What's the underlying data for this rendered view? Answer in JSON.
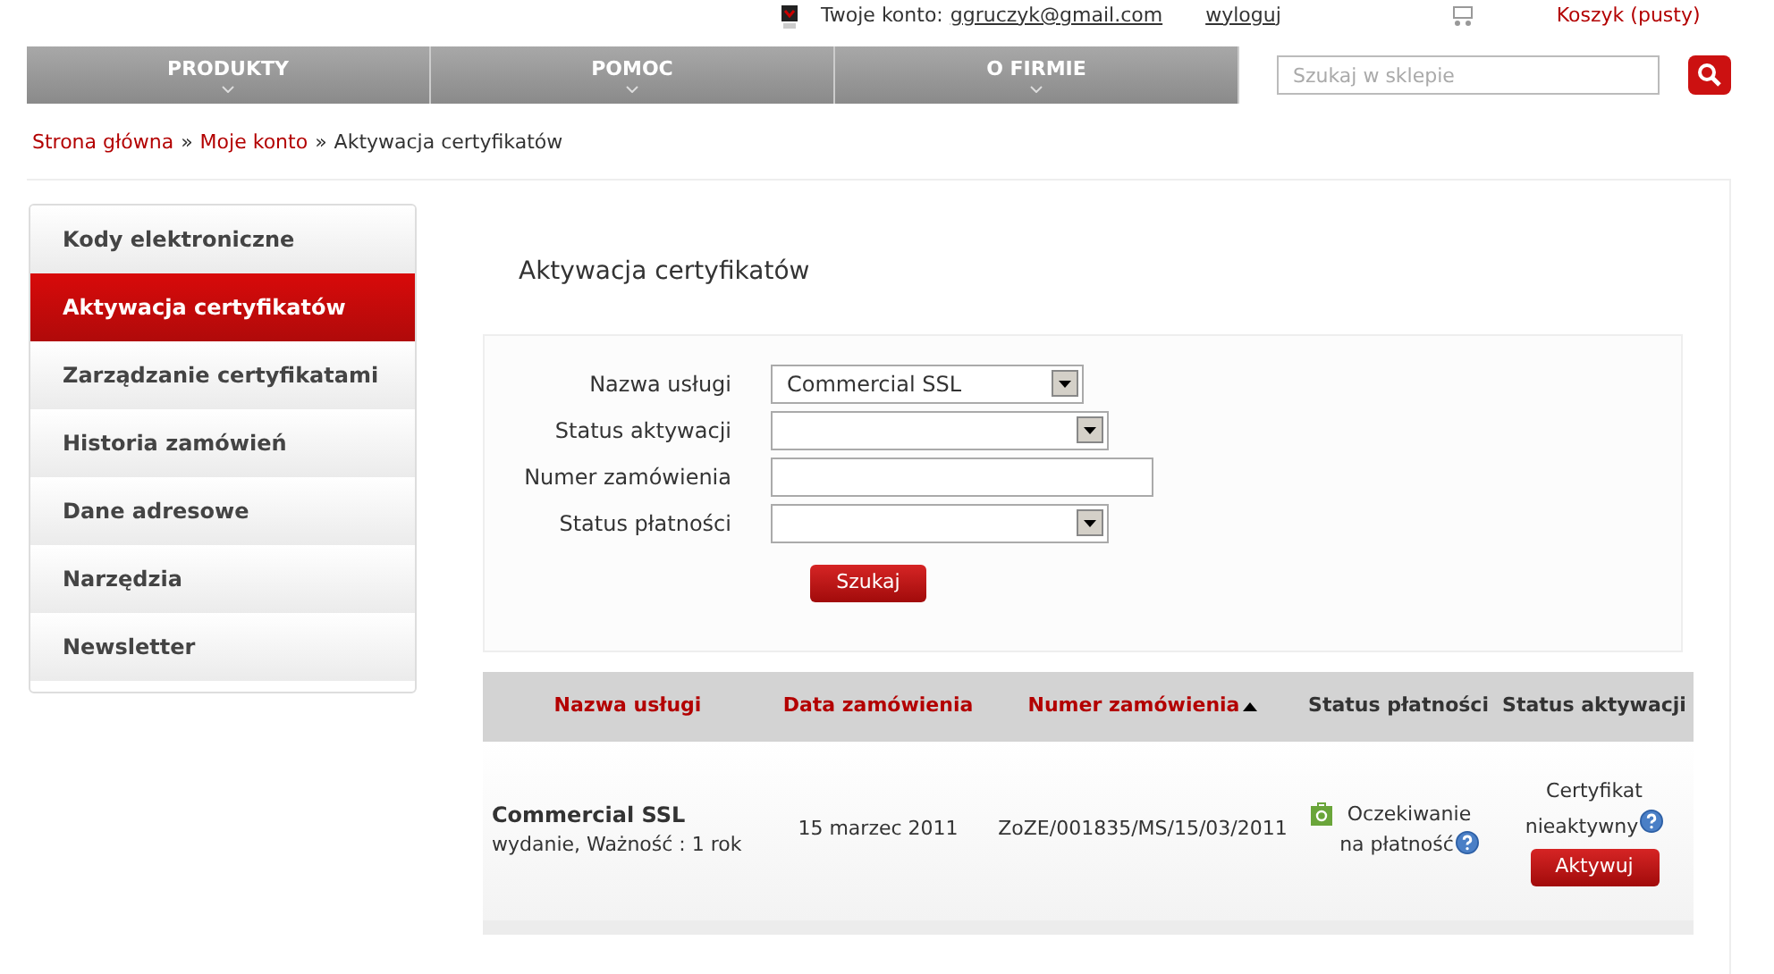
{
  "top_bar": {
    "account_label": "Twoje konto:",
    "account_email": "ggruczyk@gmail.com",
    "logout": "wyloguj",
    "cart": "Koszyk (pusty)"
  },
  "nav": [
    {
      "label": "PRODUKTY"
    },
    {
      "label": "POMOC"
    },
    {
      "label": "O FIRMIE"
    }
  ],
  "search": {
    "placeholder": "Szukaj w sklepie"
  },
  "breadcrumb": {
    "links": [
      "Strona główna",
      "Moje konto"
    ],
    "separator": "»",
    "current": "Aktywacja certyfikatów"
  },
  "sidebar": {
    "items": [
      {
        "label": "Kody elektroniczne",
        "selected": false
      },
      {
        "label": "Aktywacja certyfikatów",
        "selected": true
      },
      {
        "label": "Zarządzanie certyfikatami",
        "selected": false
      },
      {
        "label": "Historia zamówień",
        "selected": false
      },
      {
        "label": "Dane adresowe",
        "selected": false
      },
      {
        "label": "Narzędzia",
        "selected": false
      },
      {
        "label": "Newsletter",
        "selected": false
      }
    ]
  },
  "page_title": "Aktywacja certyfikatów",
  "filters": {
    "fields": [
      {
        "kind": "select",
        "label": "Nazwa usługi",
        "value": "Commercial SSL"
      },
      {
        "kind": "select",
        "label": "Status aktywacji"
      },
      {
        "kind": "text",
        "label": "Numer zamówienia"
      },
      {
        "kind": "select",
        "label": "Status płatności"
      }
    ],
    "button": "Szukaj"
  },
  "table": {
    "columns": [
      {
        "label": "Nazwa usługi",
        "link": true,
        "sorted": false
      },
      {
        "label": "Data zamówienia",
        "link": true,
        "sorted": false
      },
      {
        "label": "Numer zamówienia",
        "link": true,
        "sorted": true
      },
      {
        "label": "Status płatności",
        "link": false,
        "sorted": false
      },
      {
        "label": "Status aktywacji",
        "link": false,
        "sorted": false
      }
    ],
    "rows": [
      {
        "service": "Commercial SSL",
        "service_detail": "wydanie, Ważność : 1 rok",
        "date": "15 marzec 2011",
        "order_number": "ZoZE/001835/MS/15/03/2011",
        "payment_status": "Oczekiwanie na płatność",
        "activation_status": "Certyfikat nieaktywny",
        "action": "Aktywuj"
      }
    ]
  }
}
